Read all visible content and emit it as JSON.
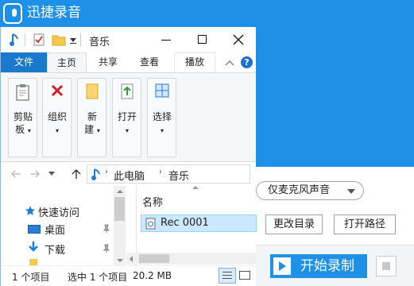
{
  "app": {
    "title": "迅捷录音",
    "format_option": "仅麦克风声音",
    "change_dir_label": "更改目录",
    "open_path_label": "打开路径",
    "record_label": "开始录制",
    "accent_color": "#1e90e6"
  },
  "explorer": {
    "window_title": "音乐",
    "tabs": {
      "file": "文件",
      "home": "主页",
      "share": "共享",
      "view": "查看",
      "play": "播放"
    },
    "ribbon": {
      "clipboard": "剪贴板",
      "organize": "组织",
      "new": "新建",
      "open": "打开",
      "select": "选择"
    },
    "breadcrumb": [
      "此电脑",
      "音乐"
    ],
    "column_header": "名称",
    "nav_items": [
      "快速访问",
      "桌面",
      "下载"
    ],
    "file": {
      "name": "Rec 0001"
    },
    "status": {
      "item_count": "1 个项目",
      "selected": "选中 1 个项目",
      "size": "20.2 MB"
    },
    "selection_color": "#cce8ff"
  }
}
